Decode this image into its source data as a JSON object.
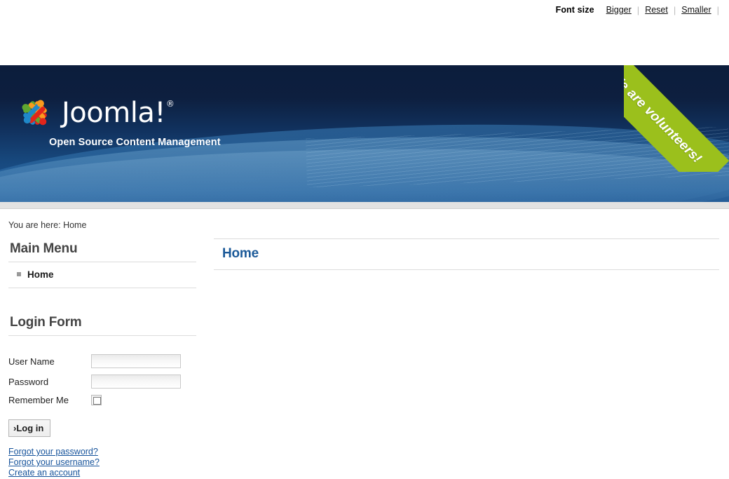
{
  "topbar": {
    "font_size_label": "Font size",
    "links": [
      {
        "label": "Bigger",
        "name": "font-size-bigger-link"
      },
      {
        "label": "Reset",
        "name": "font-size-reset-link"
      },
      {
        "label": "Smaller",
        "name": "font-size-smaller-link"
      }
    ],
    "separator": "|"
  },
  "header": {
    "brand": "Joomla!",
    "registered_mark": "®",
    "tagline": "Open Source Content Management",
    "ribbon_text": "We are volunteers!",
    "colors": {
      "navy": "#0d1f3f",
      "blue": "#1b5693",
      "ribbon_green": "#9bc01c"
    },
    "logo_colors": {
      "green": "#5fa730",
      "orange": "#f99b1d",
      "blue": "#1f88c9",
      "red": "#e1251b"
    }
  },
  "breadcrumb": {
    "text": "You are here: Home"
  },
  "sidebar": {
    "main_menu": {
      "title": "Main Menu",
      "items": [
        {
          "label": "Home"
        }
      ]
    },
    "login_form": {
      "title": "Login Form",
      "username_label": "User Name",
      "username_value": "",
      "password_label": "Password",
      "password_value": "",
      "remember_label": "Remember Me",
      "remember_checked": false,
      "submit_label": "›Log in",
      "links": [
        {
          "label": "Forgot your password?",
          "name": "forgot-password-link"
        },
        {
          "label": "Forgot your username?",
          "name": "forgot-username-link"
        },
        {
          "label": "Create an account",
          "name": "create-account-link"
        }
      ]
    }
  },
  "main": {
    "page_title": "Home"
  }
}
